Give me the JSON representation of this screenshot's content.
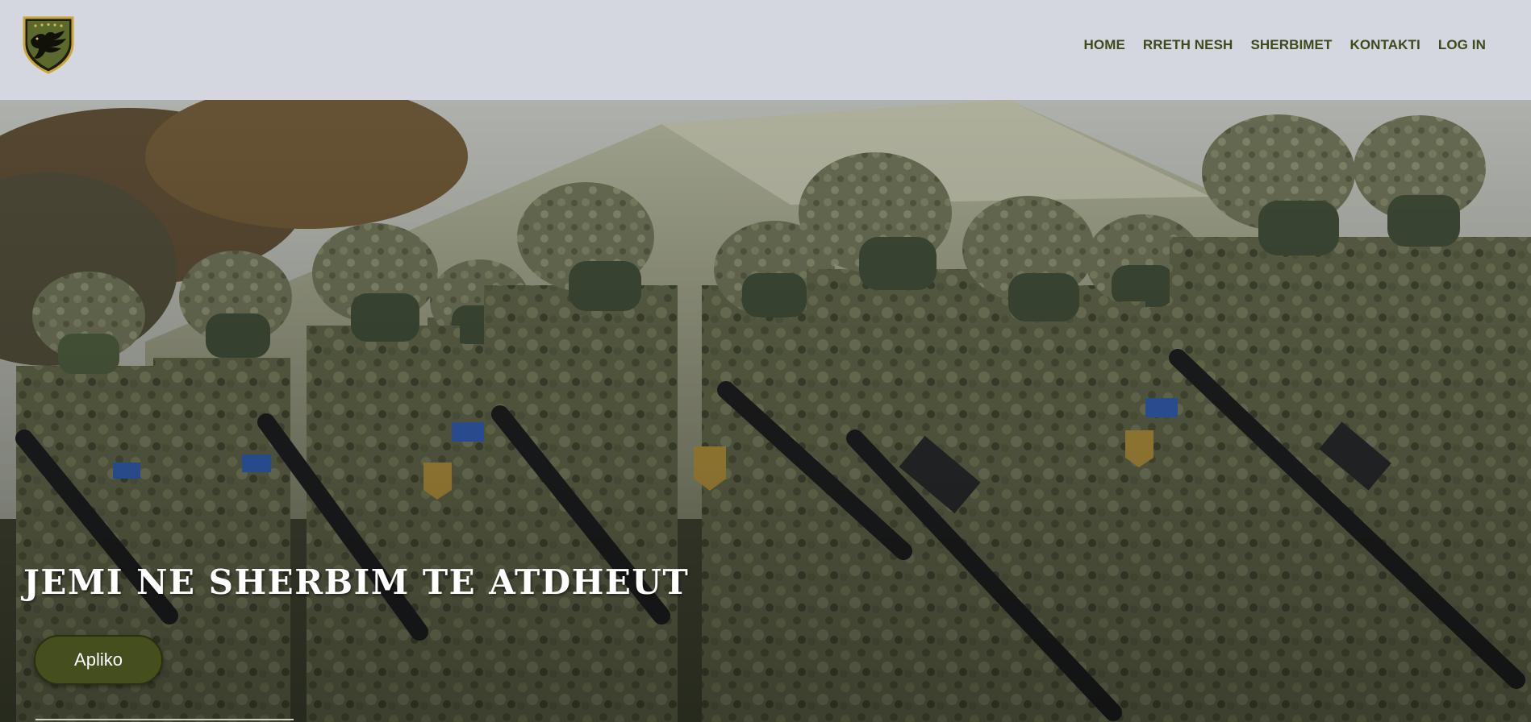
{
  "header": {
    "logo_icon": "eagle-shield-icon",
    "nav": [
      {
        "label": "HOME"
      },
      {
        "label": "RRETH NESH"
      },
      {
        "label": "SHERBIMET"
      },
      {
        "label": "KONTAKTI"
      },
      {
        "label": "LOG IN"
      }
    ]
  },
  "hero": {
    "image_description_icon": "soldiers-photo",
    "title": "JEMI NE SHERBIM TE ATDHEUT",
    "button_label": "Apliko"
  },
  "colors": {
    "header_bg": "#d4d6e0",
    "nav_text": "#3e4a1a",
    "button_bg": "#454f1e",
    "title_text": "#ffffff"
  }
}
